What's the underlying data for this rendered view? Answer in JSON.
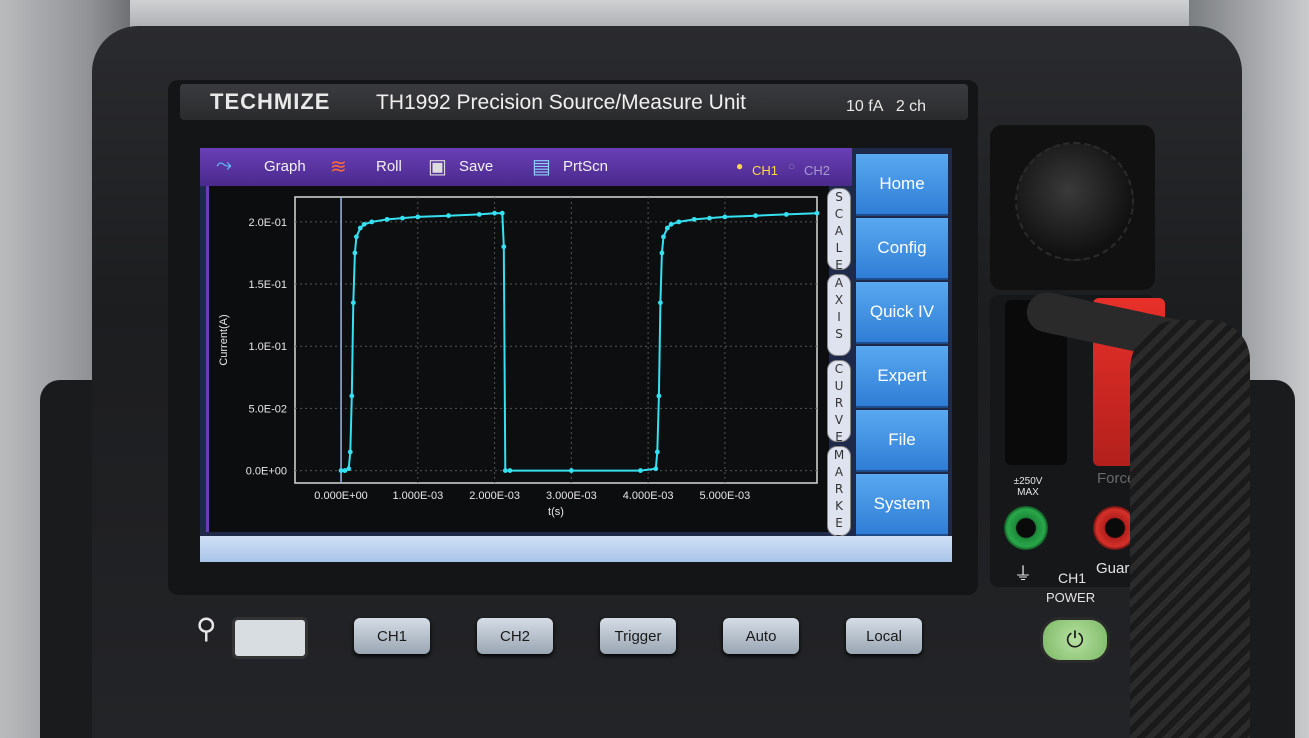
{
  "device": {
    "brand": "TECHMIZE",
    "model": "TH1992 Precision Source/Measure Unit",
    "spec": "10 fA   2 ch"
  },
  "toolbar": {
    "items": [
      "Graph",
      "Roll",
      "Save",
      "PrtScn"
    ],
    "ch1": "CH1",
    "ch2": "CH2"
  },
  "side_tabs": [
    "SCALE",
    "AXIS",
    "CURVE",
    "MARKER"
  ],
  "menu": [
    "Home",
    "Config",
    "Quick IV",
    "Expert",
    "File",
    "System"
  ],
  "hardware_buttons": [
    "CH1",
    "CH2",
    "Trigger",
    "Auto",
    "Local"
  ],
  "panel_labels": {
    "max": "±250V MAX",
    "force": "Force",
    "guard": "Guard",
    "ch1": "CH1",
    "power": "POWER"
  },
  "icons": {
    "graph": "graph-icon",
    "roll": "roll-icon",
    "save": "save-icon",
    "prtscn": "prtscn-icon",
    "usb": "usb-icon",
    "power": "power-icon",
    "ground": "ground-icon"
  },
  "colors": {
    "trace": "#35e0f0",
    "toolbar": "#5a34a8",
    "menu": "#3a8ae0"
  },
  "chart_data": {
    "type": "line",
    "xlabel": "t(s)",
    "ylabel": "Current(A)",
    "x_ticks": [
      "0.000E+00",
      "1.000E-03",
      "2.000E-03",
      "3.000E-03",
      "4.000E-03",
      "5.000E-03"
    ],
    "y_ticks": [
      "0.0E+00",
      "5.0E-02",
      "1.0E-01",
      "1.5E-01",
      "2.0E-01"
    ],
    "xlim": [
      -0.0006,
      0.0062
    ],
    "ylim": [
      -0.01,
      0.22
    ],
    "grid": true,
    "series": [
      {
        "x": [
          0.0,
          5e-05,
          0.0001,
          0.00012,
          0.00014,
          0.00016,
          0.00018,
          0.0002,
          0.00025,
          0.0003,
          0.0004,
          0.0006,
          0.0008,
          0.001,
          0.0014,
          0.0018,
          0.002,
          0.0021,
          0.00212,
          0.00214,
          0.0022,
          0.003,
          0.0039,
          0.0041,
          0.00412,
          0.00414,
          0.00416,
          0.00418,
          0.0042,
          0.00425,
          0.0043,
          0.0044,
          0.0046,
          0.0048,
          0.005,
          0.0054,
          0.0058,
          0.0062
        ],
        "y": [
          0.0,
          0.0,
          0.0015,
          0.015,
          0.06,
          0.135,
          0.175,
          0.188,
          0.195,
          0.198,
          0.2,
          0.202,
          0.203,
          0.204,
          0.205,
          0.206,
          0.207,
          0.207,
          0.18,
          0.0,
          0.0,
          0.0,
          0.0,
          0.0015,
          0.015,
          0.06,
          0.135,
          0.175,
          0.188,
          0.195,
          0.198,
          0.2,
          0.202,
          0.203,
          0.204,
          0.205,
          0.206,
          0.207
        ]
      }
    ]
  }
}
